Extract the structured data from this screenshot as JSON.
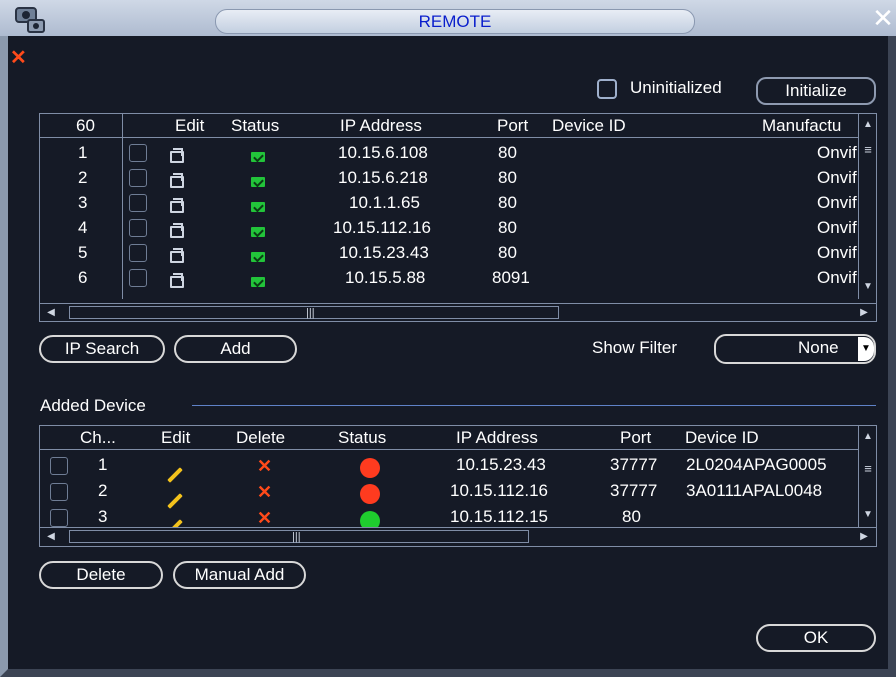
{
  "window": {
    "title": "REMOTE"
  },
  "top_bar": {
    "uninitialized_label": "Uninitialized",
    "initialize_button": "Initialize"
  },
  "device_list": {
    "columns": [
      "60",
      "Edit",
      "Status",
      "IP Address",
      "Port",
      "Device ID",
      "Manufactu"
    ],
    "rows": [
      {
        "num": "1",
        "ip": "10.15.6.108",
        "port": "80",
        "device_id": "",
        "manufacturer": "Onvif"
      },
      {
        "num": "2",
        "ip": "10.15.6.218",
        "port": "80",
        "device_id": "",
        "manufacturer": "Onvif"
      },
      {
        "num": "3",
        "ip": "10.1.1.65",
        "port": "80",
        "device_id": "",
        "manufacturer": "Onvif"
      },
      {
        "num": "4",
        "ip": "10.15.112.16",
        "port": "80",
        "device_id": "",
        "manufacturer": "Onvif"
      },
      {
        "num": "5",
        "ip": "10.15.23.43",
        "port": "80",
        "device_id": "",
        "manufacturer": "Onvif"
      },
      {
        "num": "6",
        "ip": "10.15.5.88",
        "port": "8091",
        "device_id": "",
        "manufacturer": "Onvif"
      }
    ]
  },
  "search_bar": {
    "ip_search_button": "IP Search",
    "add_button": "Add",
    "show_filter_label": "Show Filter",
    "show_filter_value": "None"
  },
  "added_device": {
    "section_title": "Added Device",
    "columns": [
      "Ch...",
      "Edit",
      "Delete",
      "Status",
      "IP Address",
      "Port",
      "Device ID"
    ],
    "rows": [
      {
        "ch": "1",
        "status_color": "#ff3b1f",
        "ip": "10.15.23.43",
        "port": "37777",
        "device_id": "2L0204APAG0005"
      },
      {
        "ch": "2",
        "status_color": "#ff3b1f",
        "ip": "10.15.112.16",
        "port": "37777",
        "device_id": "3A0111APAL0048"
      },
      {
        "ch": "3",
        "status_color": "#1fcc2e",
        "ip": "10.15.112.15",
        "port": "80",
        "device_id": ""
      }
    ]
  },
  "bottom_bar": {
    "delete_button": "Delete",
    "manual_add_button": "Manual Add",
    "ok_button": "OK"
  },
  "icons": {
    "title_icon": "camera-icon",
    "close": "close-icon",
    "panel_close": "close-icon",
    "edit": "edit-icon",
    "pencil": "pencil-icon",
    "delete": "x-icon",
    "status_online": "connected-icon"
  },
  "colors": {
    "title_text": "#0a1ecc",
    "panel_bg": "#151a26",
    "accent_close": "#ff4a1a",
    "status_green": "#22c43a",
    "status_red": "#ff3b1f"
  }
}
